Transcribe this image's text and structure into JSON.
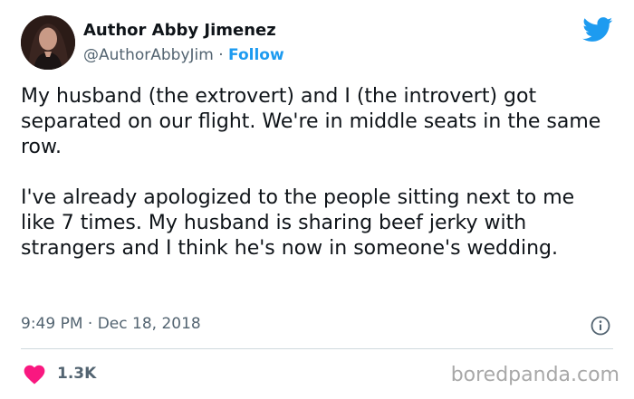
{
  "author": {
    "name": "Author Abby Jimenez",
    "handle": "@AuthorAbbyJim",
    "separator": " · ",
    "follow_label": "Follow"
  },
  "tweet": {
    "paragraph_1": "My husband (the extrovert) and I (the introvert) got separated on our flight. We're in middle seats in the same row.",
    "paragraph_2": "I've already apologized to the people sitting next to me like 7 times. My husband is sharing beef jerky with strangers and I think he's now in someone's wedding.",
    "time": "9:49 PM",
    "date_separator": " · ",
    "date": "Dec 18, 2018",
    "likes": "1.3K"
  },
  "watermark": "boredpanda.com",
  "icons": {
    "platform": "twitter-bird-icon",
    "info": "info-icon",
    "like": "heart-icon"
  },
  "colors": {
    "accent": "#1d9bf0",
    "like": "#f91880",
    "muted": "#536471"
  }
}
